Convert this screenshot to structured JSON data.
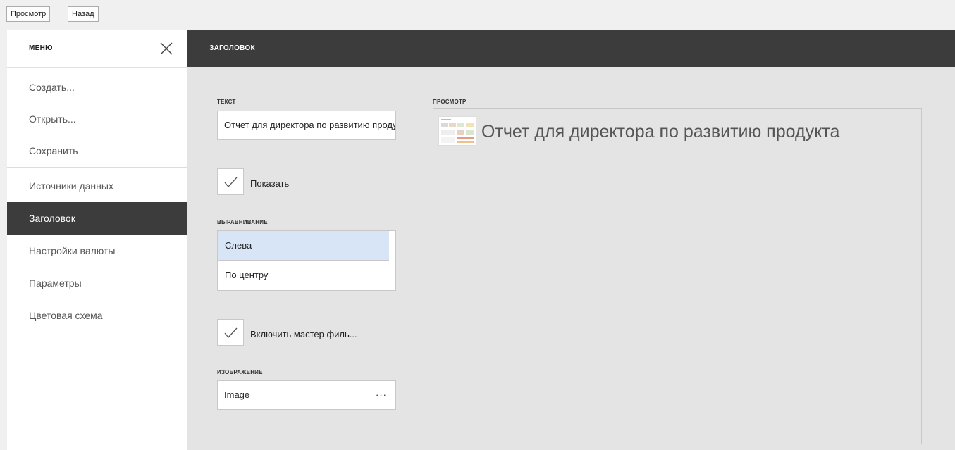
{
  "toolbar": {
    "preview_label": "Просмотр",
    "back_label": "Назад"
  },
  "menu": {
    "title": "МЕНЮ",
    "items": [
      {
        "label": "Создать..."
      },
      {
        "label": "Открыть..."
      },
      {
        "label": "Сохранить"
      },
      {
        "label": "Источники данных"
      },
      {
        "label": "Заголовок",
        "active": true
      },
      {
        "label": "Настройки валюты"
      },
      {
        "label": "Параметры"
      },
      {
        "label": "Цветовая схема"
      }
    ]
  },
  "content": {
    "title": "ЗАГОЛОВОК",
    "text_label": "ТЕКСТ",
    "text_value": "Отчет для директора по развитию продукта",
    "show_checkbox": {
      "label": "Показать",
      "checked": true
    },
    "alignment_label": "ВЫРАВНИВАНИЕ",
    "alignment_options": [
      {
        "label": "Слева",
        "selected": true
      },
      {
        "label": "По центру",
        "selected": false
      }
    ],
    "filter_wizard_checkbox": {
      "label": "Включить мастер филь...",
      "checked": true
    },
    "image_label": "ИЗОБРАЖЕНИЕ",
    "image_value": "Image",
    "image_more": "···",
    "preview_label": "ПРОСМОТР",
    "preview_title": "Отчет для директора по развитию продукта"
  },
  "colors": {
    "dark_header": "#3c3c3c",
    "selected_option": "#d7e5f7",
    "panel_bg": "#e4e4e4"
  }
}
